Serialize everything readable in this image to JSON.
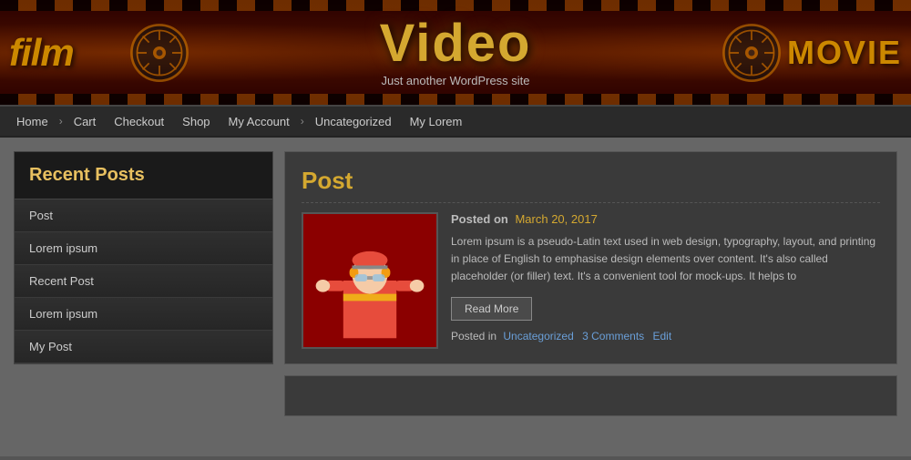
{
  "header": {
    "site_title": "Video",
    "tagline": "Just another WordPress site",
    "film_text": "film",
    "movie_text": "MOVIE"
  },
  "navbar": {
    "items": [
      {
        "label": "Home",
        "has_arrow": false
      },
      {
        "label": "›",
        "is_separator": true
      },
      {
        "label": "Cart",
        "has_arrow": false
      },
      {
        "label": "Checkout",
        "has_arrow": false
      },
      {
        "label": "Shop",
        "has_arrow": false
      },
      {
        "label": "My Account",
        "has_arrow": false
      },
      {
        "label": "›",
        "is_separator": true
      },
      {
        "label": "Uncategorized",
        "has_arrow": false
      },
      {
        "label": "My Lorem",
        "has_arrow": false
      }
    ]
  },
  "sidebar": {
    "recent_posts_title": "Recent Posts",
    "recent_posts": [
      {
        "label": "Post"
      },
      {
        "label": "Lorem ipsum"
      },
      {
        "label": "Recent Post"
      },
      {
        "label": "Lorem ipsum"
      },
      {
        "label": "My Post"
      }
    ]
  },
  "main": {
    "post": {
      "title": "Post",
      "posted_on_label": "Posted on",
      "posted_on_date": "March 20, 2017",
      "excerpt": "Lorem ipsum is a pseudo-Latin text used in web design, typography, layout, and printing in place of English to emphasise design elements over content. It's also called placeholder (or filler) text. It's a convenient tool for mock-ups. It helps to",
      "read_more_label": "Read More",
      "posted_in_label": "Posted in",
      "category": "Uncategorized",
      "comments": "3 Comments",
      "edit": "Edit"
    }
  },
  "colors": {
    "accent_gold": "#d4a830",
    "link_blue": "#6a9fd8",
    "bg_dark": "#2a2a2a",
    "bg_medium": "#3a3a3a"
  }
}
